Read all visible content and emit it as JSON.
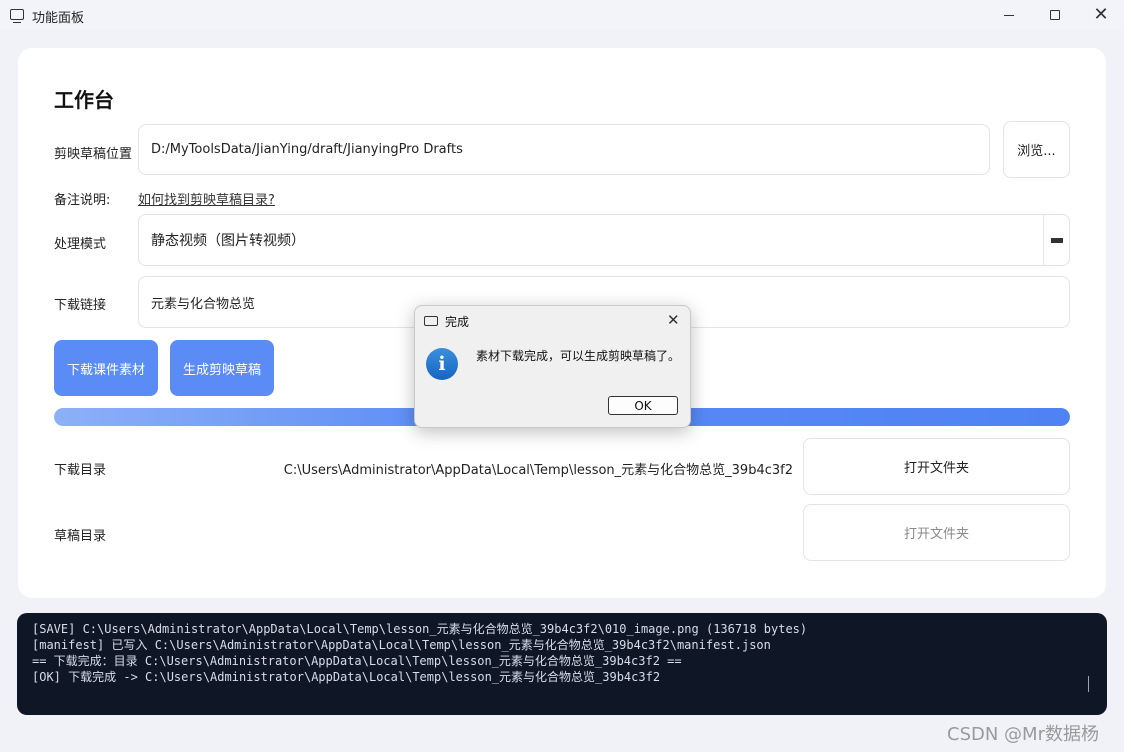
{
  "window": {
    "title": "功能面板"
  },
  "main": {
    "title": "工作台",
    "draft_location": {
      "label": "剪映草稿位置",
      "value": "D:/MyToolsData/JianYing/draft/JianyingPro Drafts",
      "browse_label": "浏览..."
    },
    "note": {
      "label": "备注说明:",
      "link_text": "如何找到剪映草稿目录?"
    },
    "mode": {
      "label": "处理模式",
      "value": "静态视频（图片转视频）"
    },
    "download_link": {
      "label": "下载链接",
      "value": "元素与化合物总览"
    },
    "buttons": {
      "download_label": "下载课件素材",
      "generate_label": "生成剪映草稿"
    },
    "progress": 1.0,
    "download_dir": {
      "label": "下载目录",
      "path": "C:\\Users\\Administrator\\AppData\\Local\\Temp\\lesson_元素与化合物总览_39b4c3f2",
      "open_label": "打开文件夹"
    },
    "draft_dir": {
      "label": "草稿目录",
      "path": "",
      "open_label": "打开文件夹"
    }
  },
  "console": {
    "lines": [
      "[SAVE] C:\\Users\\Administrator\\AppData\\Local\\Temp\\lesson_元素与化合物总览_39b4c3f2\\010_image.png (136718 bytes)",
      "[manifest] 已写入 C:\\Users\\Administrator\\AppData\\Local\\Temp\\lesson_元素与化合物总览_39b4c3f2\\manifest.json",
      "== 下载完成：目录 C:\\Users\\Administrator\\AppData\\Local\\Temp\\lesson_元素与化合物总览_39b4c3f2 ==",
      "[OK] 下载完成 -> C:\\Users\\Administrator\\AppData\\Local\\Temp\\lesson_元素与化合物总览_39b4c3f2"
    ]
  },
  "dialog": {
    "title": "完成",
    "message": "素材下载完成，可以生成剪映草稿了。",
    "ok_label": "OK",
    "icon": "info-icon"
  },
  "watermark": "CSDN @Mr数据杨",
  "colors": {
    "accent": "#5b8cf6",
    "console_bg": "#0f1626"
  }
}
